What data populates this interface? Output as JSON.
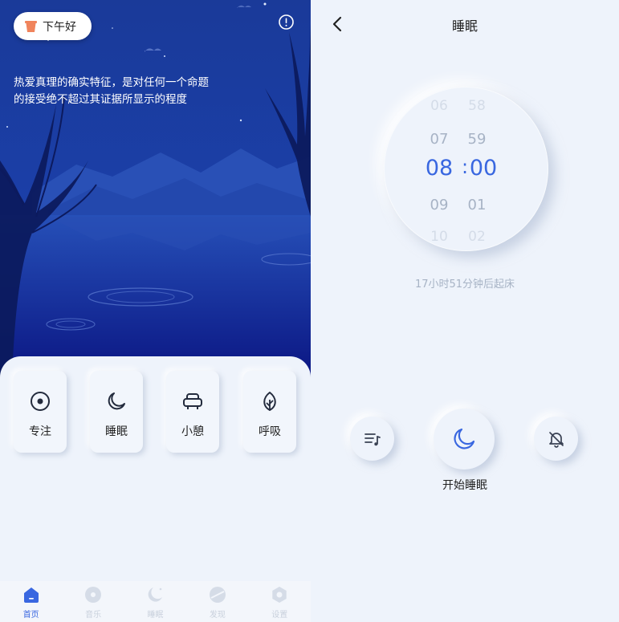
{
  "home": {
    "greeting": "下午好",
    "quote": "热爱真理的确实特征，是对任何一个命题的接受绝不超过其证据所显示的程度",
    "cards": [
      {
        "label": "专注",
        "icon": "target-icon"
      },
      {
        "label": "睡眠",
        "icon": "moon-icon"
      },
      {
        "label": "小憩",
        "icon": "armchair-icon"
      },
      {
        "label": "呼吸",
        "icon": "leaf-icon"
      }
    ],
    "tabs": [
      {
        "label": "首页",
        "icon": "home-icon",
        "active": true
      },
      {
        "label": "音乐",
        "icon": "music-disc-icon",
        "active": false
      },
      {
        "label": "睡眠",
        "icon": "moon-stars-icon",
        "active": false
      },
      {
        "label": "发现",
        "icon": "planet-icon",
        "active": false
      },
      {
        "label": "设置",
        "icon": "settings-icon",
        "active": false
      }
    ]
  },
  "sleep": {
    "title": "睡眠",
    "picker": {
      "hours": [
        "06",
        "07",
        "08",
        "09",
        "10"
      ],
      "minutes": [
        "58",
        "59",
        "00",
        "01",
        "02"
      ],
      "separator": ":"
    },
    "remaining": "17小时51分钟后起床",
    "start_label": "开始睡眠"
  },
  "colors": {
    "accent": "#3967e0",
    "night_top": "#1c3b9a",
    "night_bottom": "#0a1480",
    "background": "#eef3fb"
  }
}
